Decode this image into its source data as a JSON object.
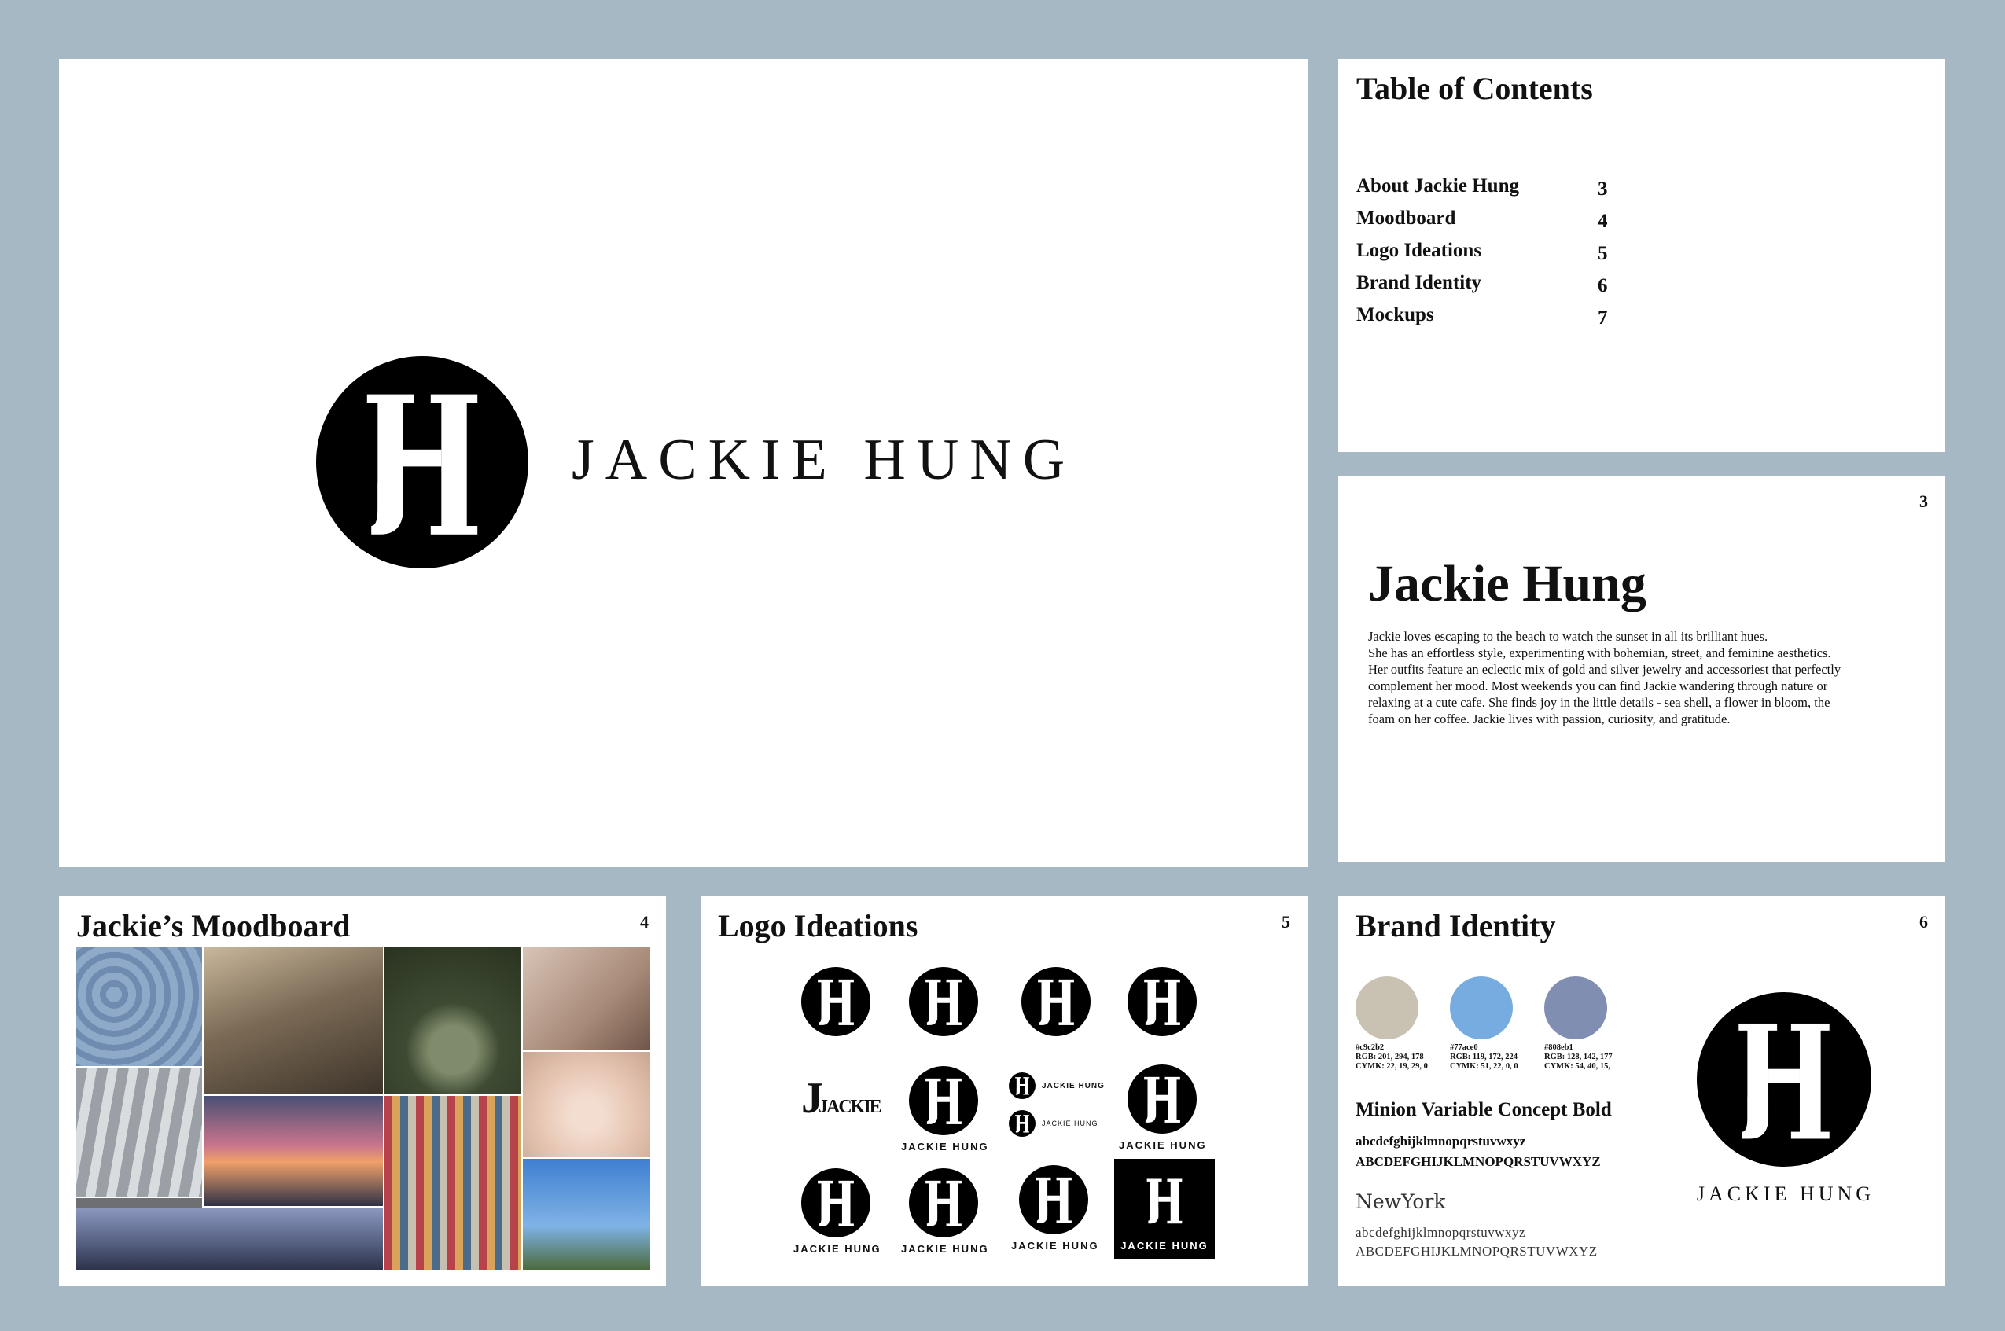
{
  "colors": {
    "background": "#a7b8c5",
    "ink": "#111111"
  },
  "cover": {
    "logo": "jh-monogram-icon",
    "wordmark": "JACKIE HUNG"
  },
  "toc": {
    "title": "Table of Contents",
    "items": [
      {
        "label": "About Jackie Hung",
        "page": "3"
      },
      {
        "label": "Moodboard",
        "page": "4"
      },
      {
        "label": "Logo Ideations",
        "page": "5"
      },
      {
        "label": "Brand Identity",
        "page": "6"
      },
      {
        "label": "Mockups",
        "page": "7"
      }
    ]
  },
  "about": {
    "page": "3",
    "name": "Jackie Hung",
    "lines": [
      "Jackie loves escaping to the beach to watch the sunset in all its brilliant hues.",
      "She has an effortless style, experimenting with bohemian, street, and feminine aesthetics.",
      "Her outfits feature an eclectic mix of gold and silver jewelry and accessoriest that perfectly",
      "complement her mood. Most weekends you can find Jackie wandering through nature or",
      "relaxing at a cute cafe. She finds joy in the little details - sea shell, a flower in bloom, the",
      "foam on her coffee. Jackie lives with passion, curiosity, and gratitude."
    ]
  },
  "moodboard": {
    "title": "Jackie’s Moodboard",
    "page": "4"
  },
  "logos": {
    "title": "Logo Ideations",
    "page": "5",
    "variant_b_caption": "JACKIE",
    "stack_caption_1": "JACKIE HUNG",
    "stack_caption_2": "JACKIE HUNG",
    "caption": "JACKIE HUNG"
  },
  "brand": {
    "title": "Brand Identity",
    "page": "6",
    "swatches": [
      {
        "hex": "#c9c2b2",
        "rgb": "RGB: 201, 294, 178",
        "cymk": "CYMK: 22, 19, 29, 0"
      },
      {
        "hex": "#77ace0",
        "rgb": "RGB: 119, 172, 224",
        "cymk": "CYMK: 51, 22, 0, 0"
      },
      {
        "hex": "#808eb1",
        "rgb": "RGB: 128, 142, 177",
        "cymk": "CYMK: 54, 40, 15,"
      }
    ],
    "font1_name": "Minion Variable Concept Bold",
    "font1_lower": "abcdefghijklmnopqrstuvwxyz",
    "font1_upper": "ABCDEFGHIJKLMNOPQRSTUVWXYZ",
    "font2_name": "NewYork",
    "font2_lower": "abcdefghijklmnopqrstuvwxyz",
    "font2_upper": "ABCDEFGHIJKLMNOPQRSTUVWXYZ",
    "wordmark": "JACKIE HUNG"
  }
}
